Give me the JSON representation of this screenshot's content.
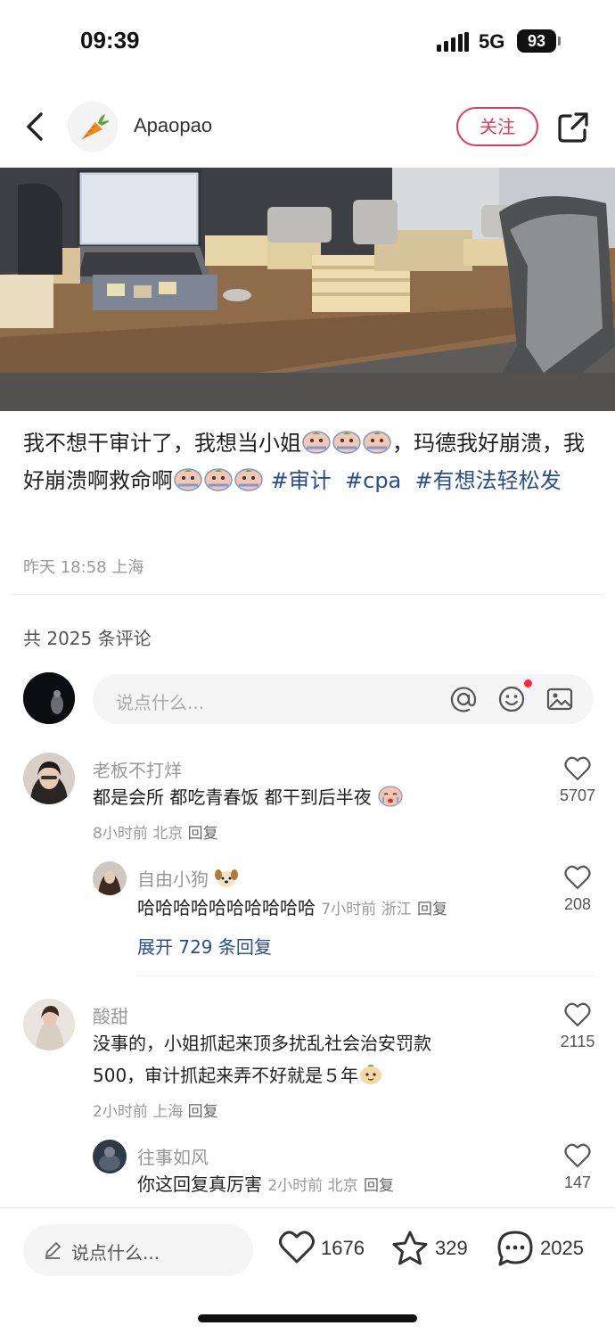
{
  "status_bar": {
    "time": "09:39",
    "network": "5G",
    "battery": "93"
  },
  "header": {
    "author": "Apaopao",
    "follow_label": "关注"
  },
  "post": {
    "text_part1": "我不想干审计了，我想当小姐",
    "text_part2": "，玛德我好崩溃，我好崩溃啊救命啊",
    "tags": [
      "#审计",
      "#cpa",
      "#有想法",
      "轻松发"
    ],
    "meta": "昨天 18:58 上海"
  },
  "comments_header": "共 2025 条评论",
  "comment_input": {
    "placeholder": "说点什么..."
  },
  "comments": [
    {
      "name": "老板不打烊",
      "text": "都是会所 都吃青春饭 都干到后半夜",
      "meta": "8小时前 北京",
      "reply": "回复",
      "likes": "5707"
    },
    {
      "name": "自由小狗",
      "text": "哈哈哈哈哈哈哈哈哈哈",
      "meta": "7小时前 浙江",
      "reply": "回复",
      "likes": "208"
    },
    {
      "name": "酸甜",
      "text_line1": "没事的，小姐抓起来顶多扰乱社会治安罚款",
      "text_line2": "500，审计抓起来弄不好就是５年",
      "meta": "2小时前 上海",
      "reply": "回复",
      "likes": "2115"
    },
    {
      "name": "往事如风",
      "text": "你这回复真厉害",
      "meta": "2小时前 北京",
      "reply": "回复",
      "likes": "147"
    }
  ],
  "expand_replies": "展开 729 条回复",
  "bottom_bar": {
    "placeholder": "说点什么...",
    "likes": "1676",
    "favorites": "329",
    "comments": "2025"
  },
  "colors": {
    "accent": "#e23b57",
    "tag": "#2a4d8f",
    "notify_dot": "#ff2442"
  }
}
